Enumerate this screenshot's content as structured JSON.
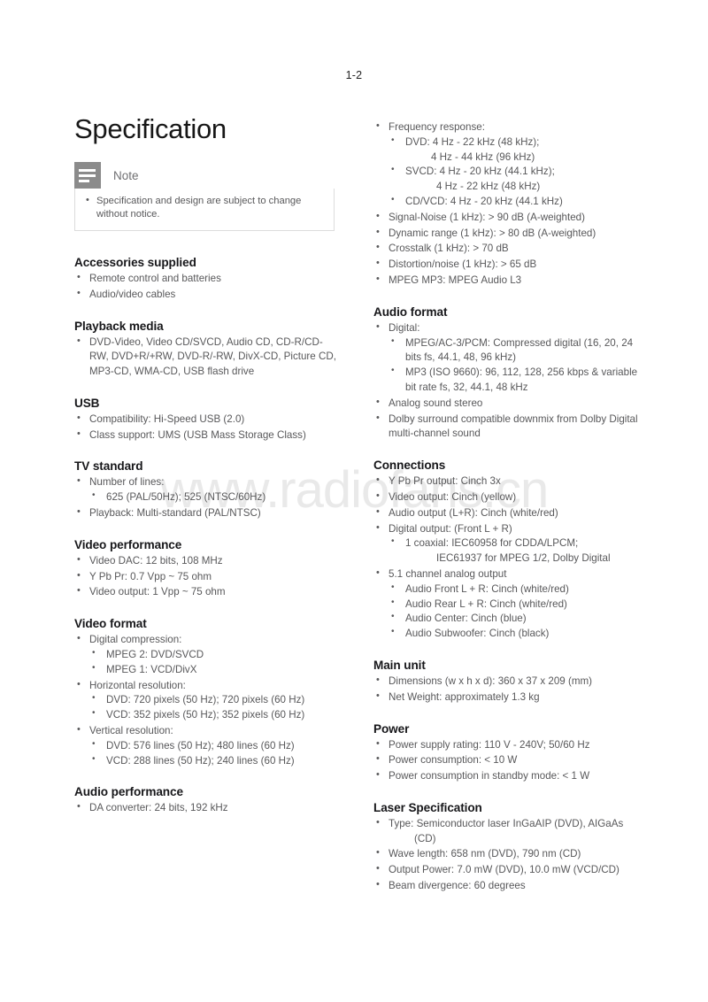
{
  "page": {
    "number": "1-2",
    "watermark": "www.radiofans.cn",
    "title": "Specification"
  },
  "note": {
    "icon": "note-lines-icon",
    "label": "Note",
    "items": [
      "Specification and design are subject to change without notice."
    ]
  },
  "left_column": [
    {
      "heading": "Accessories supplied",
      "items": [
        {
          "text": "Remote control and batteries"
        },
        {
          "text": "Audio/video cables"
        }
      ]
    },
    {
      "heading": "Playback media",
      "items": [
        {
          "text": "DVD-Video, Video CD/SVCD, Audio CD, CD-R/CD-RW, DVD+R/+RW, DVD-R/-RW, DivX-CD, Picture CD, MP3-CD, WMA-CD, USB flash drive"
        }
      ]
    },
    {
      "heading": "USB",
      "items": [
        {
          "text": "Compatibility: Hi-Speed USB (2.0)"
        },
        {
          "text": "Class support: UMS (USB Mass Storage Class)"
        }
      ]
    },
    {
      "heading": "TV standard",
      "items": [
        {
          "text": "Number of lines:",
          "sub": [
            {
              "text": "625 (PAL/50Hz); 525 (NTSC/60Hz)"
            }
          ]
        },
        {
          "text": "Playback: Multi-standard (PAL/NTSC)"
        }
      ]
    },
    {
      "heading": "Video performance",
      "items": [
        {
          "text": "Video DAC: 12 bits, 108 MHz"
        },
        {
          "text": "Y Pb Pr: 0.7 Vpp ~ 75 ohm"
        },
        {
          "text": "Video output: 1 Vpp ~ 75 ohm"
        }
      ]
    },
    {
      "heading": "Video format",
      "items": [
        {
          "text": "Digital compression:",
          "sub": [
            {
              "text": "MPEG 2: DVD/SVCD"
            },
            {
              "text": "MPEG 1: VCD/DivX"
            }
          ]
        },
        {
          "text": "Horizontal resolution:",
          "sub": [
            {
              "text": "DVD: 720 pixels (50 Hz); 720 pixels (60 Hz)"
            },
            {
              "text": "VCD: 352 pixels (50 Hz); 352 pixels (60 Hz)"
            }
          ]
        },
        {
          "text": "Vertical resolution:",
          "sub": [
            {
              "text": "DVD: 576 lines (50 Hz); 480 lines (60 Hz)"
            },
            {
              "text": "VCD: 288 lines (50 Hz); 240 lines (60 Hz)"
            }
          ]
        }
      ]
    },
    {
      "heading": "Audio performance",
      "items": [
        {
          "text": "DA converter: 24 bits, 192 kHz"
        }
      ]
    }
  ],
  "right_column": [
    {
      "heading": "",
      "items": [
        {
          "text": "Frequency response:",
          "sub": [
            {
              "text": "DVD: 4 Hz - 22 kHz (48 kHz);",
              "cont": "4 Hz - 44 kHz (96 kHz)"
            },
            {
              "text": "SVCD: 4 Hz - 20 kHz (44.1 kHz);",
              "cont_wide": "4 Hz - 22 kHz (48 kHz)"
            },
            {
              "text": "CD/VCD:  4 Hz - 20 kHz (44.1 kHz)"
            }
          ]
        },
        {
          "text": "Signal-Noise (1 kHz): > 90 dB (A-weighted)"
        },
        {
          "text": "Dynamic range (1 kHz): > 80 dB (A-weighted)"
        },
        {
          "text": "Crosstalk (1 kHz): > 70 dB"
        },
        {
          "text": "Distortion/noise (1 kHz): > 65 dB"
        },
        {
          "text": "MPEG MP3: MPEG Audio L3"
        }
      ]
    },
    {
      "heading": "Audio format",
      "items": [
        {
          "text": "Digital:",
          "sub": [
            {
              "text": "MPEG/AC-3/PCM: Compressed digital (16, 20, 24 bits fs, 44.1, 48, 96 kHz)"
            },
            {
              "text": "MP3 (ISO 9660): 96, 112, 128, 256 kbps & variable bit rate fs, 32, 44.1, 48 kHz"
            }
          ]
        },
        {
          "text": "Analog sound stereo"
        },
        {
          "text": "Dolby surround compatible downmix from Dolby Digital multi-channel sound"
        }
      ]
    },
    {
      "heading": "Connections",
      "items": [
        {
          "text": "Y Pb Pr output: Cinch 3x"
        },
        {
          "text": "Video output: Cinch (yellow)"
        },
        {
          "text": "Audio output (L+R): Cinch (white/red)"
        },
        {
          "text": "Digital output: (Front L + R)",
          "sub": [
            {
              "text": "1 coaxial: IEC60958 for CDDA/LPCM;",
              "cont_wide": "IEC61937 for MPEG 1/2, Dolby Digital"
            }
          ]
        },
        {
          "text": "5.1 channel analog output",
          "sub": [
            {
              "text": "Audio Front L + R: Cinch (white/red)"
            },
            {
              "text": "Audio Rear L + R: Cinch (white/red)"
            },
            {
              "text": "Audio Center: Cinch (blue)"
            },
            {
              "text": "Audio Subwoofer: Cinch (black)"
            }
          ]
        }
      ]
    },
    {
      "heading": "Main unit",
      "items": [
        {
          "text": "Dimensions (w x h x d): 360 x 37 x 209 (mm)"
        },
        {
          "text": "Net Weight: approximately 1.3 kg"
        }
      ]
    },
    {
      "heading": "Power",
      "items": [
        {
          "text": "Power supply rating: 110 V - 240V; 50/60 Hz"
        },
        {
          "text": "Power consumption: < 10 W"
        },
        {
          "text": "Power consumption in standby mode: < 1 W"
        }
      ]
    },
    {
      "heading": "Laser Specification",
      "items": [
        {
          "text": "Type: Semiconductor laser InGaAIP (DVD), AIGaAs",
          "cont": "(CD)"
        },
        {
          "text": "Wave length: 658 nm (DVD), 790 nm (CD)"
        },
        {
          "text": "Output Power: 7.0 mW (DVD), 10.0 mW (VCD/CD)"
        },
        {
          "text": "Beam divergence: 60 degrees"
        }
      ]
    }
  ],
  "colors": {
    "heading": "#17171a",
    "body": "#58585a",
    "note_icon_bg": "#8b8b8b",
    "note_border": "#dcdcdc",
    "watermark": "#e9e9e9"
  }
}
